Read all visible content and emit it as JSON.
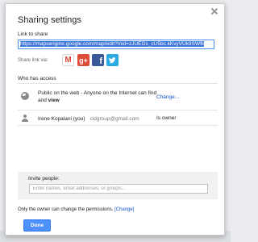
{
  "dialog": {
    "title": "Sharing settings",
    "link_label": "Link to share",
    "link_url": "https://mapsengine.google.com/map/edit?mid=zJUEGs_cU5bc.kKvyVUk9SWfk",
    "share_via_label": "Share link via:",
    "share_icons": [
      "gmail-icon",
      "google-plus-icon",
      "facebook-icon",
      "twitter-icon"
    ],
    "who_has_access": "Who has access",
    "access_rows": [
      {
        "icon": "globe-icon",
        "text_prefix": "Public on the web - Anyone on the Internet can find and ",
        "text_bold": "view",
        "action": "Change..."
      },
      {
        "icon": "person-icon",
        "name": "Irene Kopalani (you)",
        "email": "cidgroup@gmail.com",
        "role": "Is owner"
      }
    ],
    "invite_label": "Invite people:",
    "invite_placeholder": "Enter names, email addresses, or groups...",
    "permission_text": "Only the owner can change the permissions.",
    "permission_link": "[Change]",
    "done_label": "Done"
  },
  "colors": {
    "accent": "#4d90fe",
    "link": "#1155cc",
    "gplus": "#dd4b39",
    "facebook": "#3b5998",
    "twitter": "#2ba9e1"
  }
}
